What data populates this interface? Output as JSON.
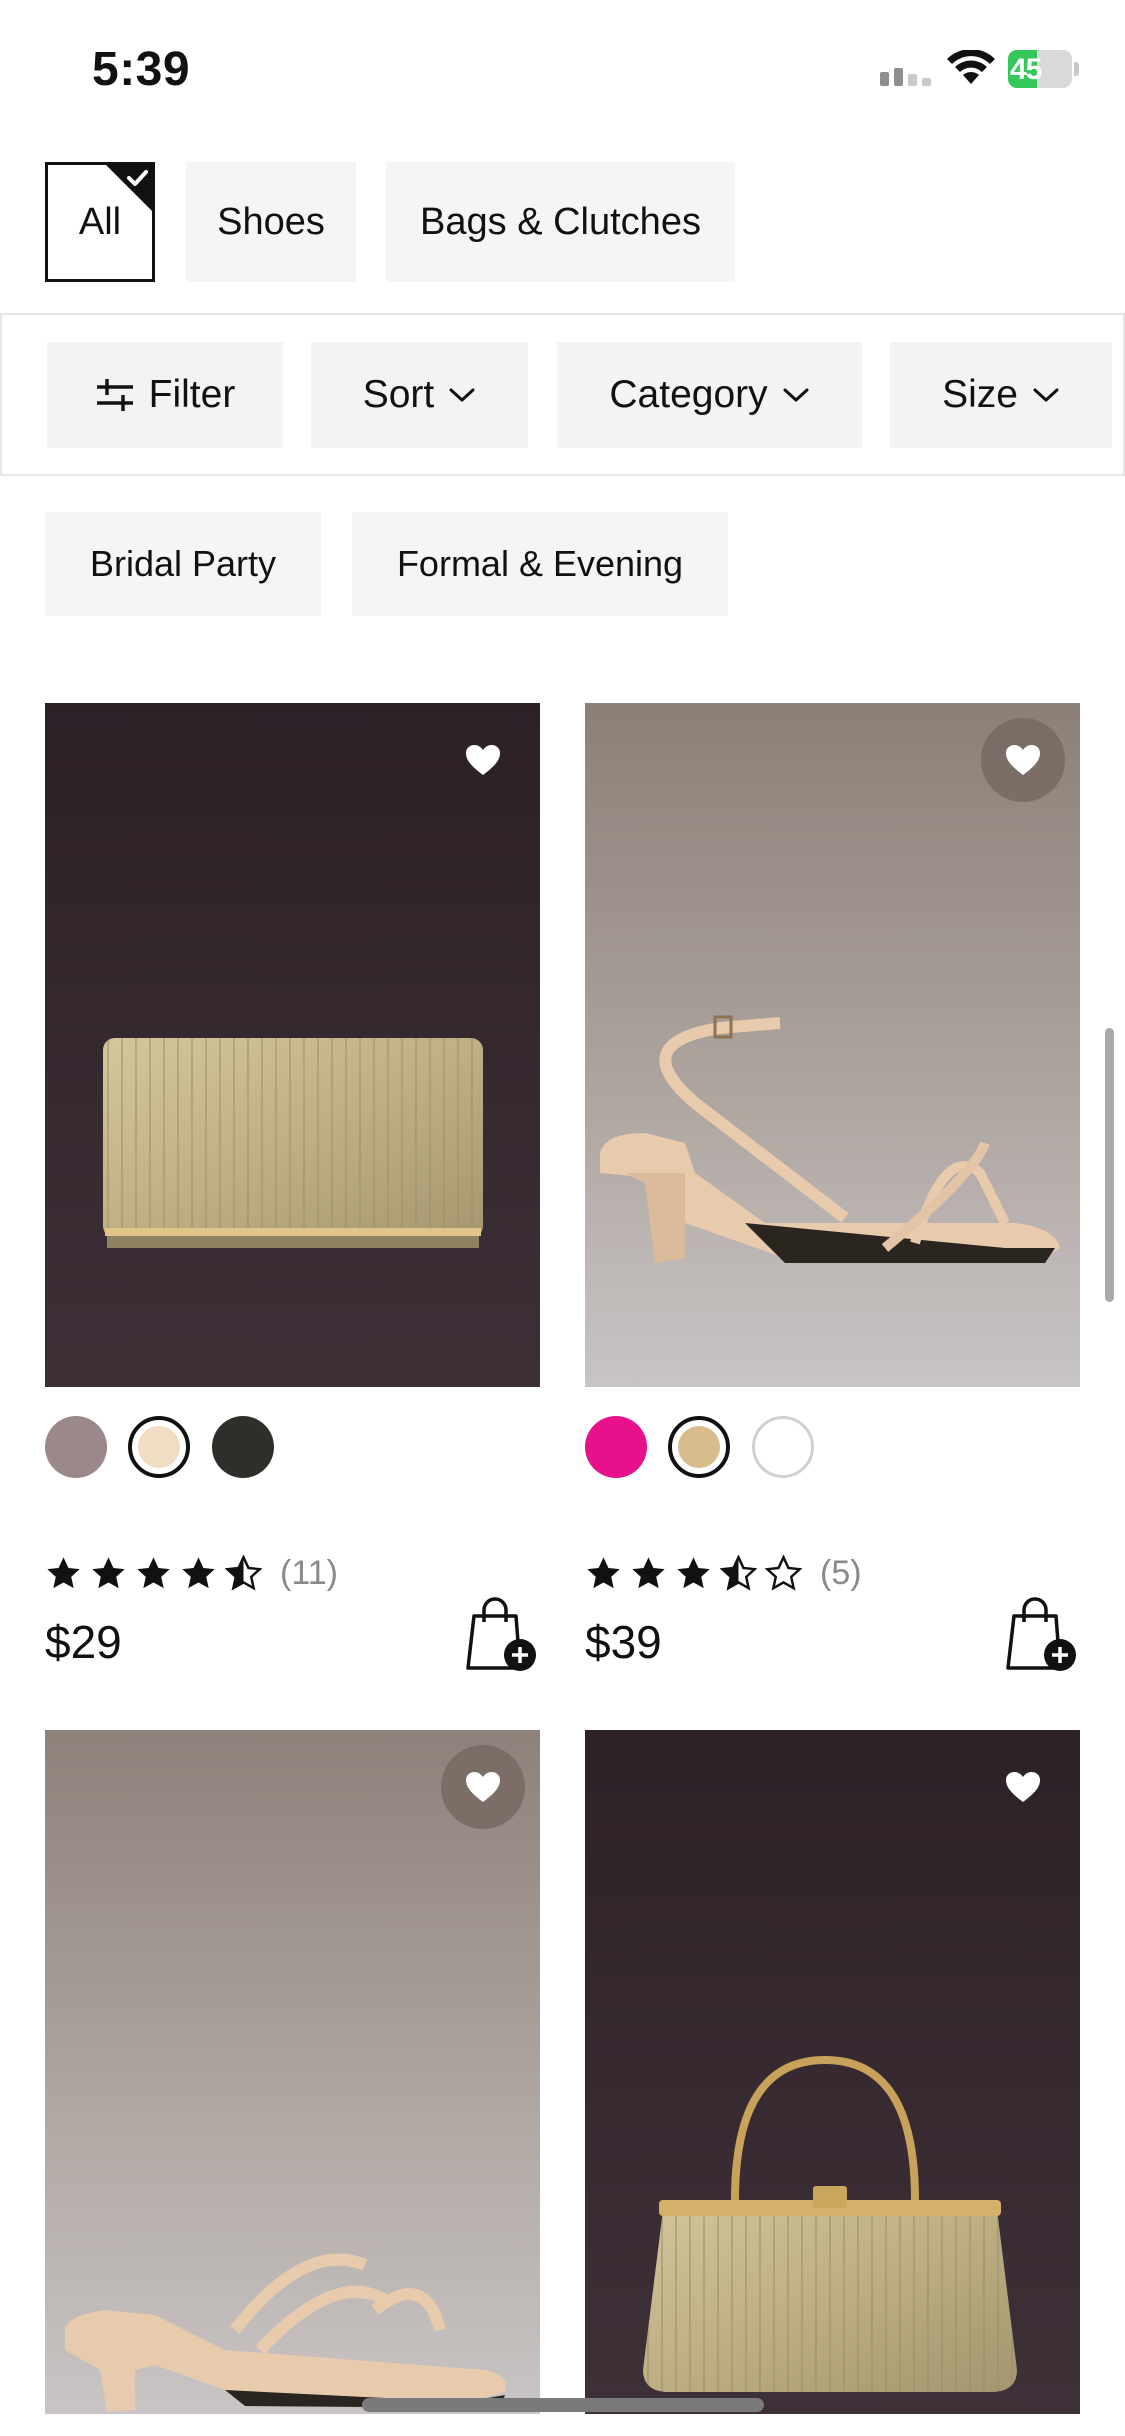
{
  "status_bar": {
    "time": "5:39",
    "battery_percent": "45",
    "battery_level": 0.45,
    "battery_color": "#34c759"
  },
  "category_tabs": [
    {
      "label": "All",
      "selected": true
    },
    {
      "label": "Shoes",
      "selected": false
    },
    {
      "label": "Bags & Clutches",
      "selected": false
    }
  ],
  "filters": {
    "filter_label": "Filter",
    "sort_label": "Sort",
    "category_label": "Category",
    "size_label": "Size",
    "icons": [
      "sliders-icon",
      "chevron-down-icon"
    ]
  },
  "subcategories": [
    "Bridal Party",
    "Formal & Evening"
  ],
  "products": [
    {
      "image": "gold-pleated-clutch",
      "swatches": [
        "#9b888b",
        "#f3dcc4",
        "#2d2f2a"
      ],
      "selected_swatch": 1,
      "rating": 4.5,
      "review_count": "(11)",
      "price": "$29"
    },
    {
      "image": "nude-block-heel-sandal",
      "swatches": [
        "#e8118c",
        "#d7bd8e",
        "#ffffff"
      ],
      "selected_swatch": 1,
      "rating": 3.5,
      "review_count": "(5)",
      "price": "$39"
    },
    {
      "image": "nude-strappy-heel-mule"
    },
    {
      "image": "gold-pleated-frame-handbag"
    }
  ],
  "icons": {
    "wishlist": "heart-icon",
    "add_to_bag": "shopping-bag-add-icon",
    "rating": "star-icon"
  }
}
